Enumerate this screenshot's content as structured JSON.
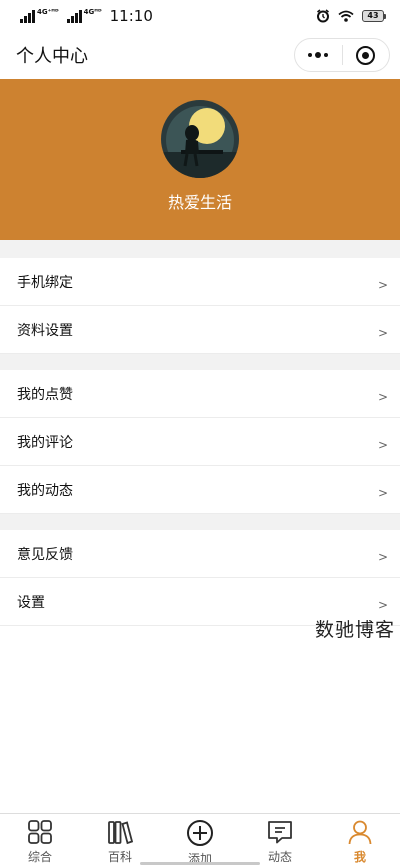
{
  "status_bar": {
    "network_1": "4G⁺ᴴᴰ",
    "network_2": "4Gᴴᴰ",
    "time": "11:10",
    "battery": "43"
  },
  "header": {
    "title": "个人中心"
  },
  "profile": {
    "username": "热爱生活",
    "banner_color": "#cd8230"
  },
  "menu": {
    "groups": [
      {
        "items": [
          {
            "label": "手机绑定"
          },
          {
            "label": "资料设置"
          }
        ]
      },
      {
        "items": [
          {
            "label": "我的点赞"
          },
          {
            "label": "我的评论"
          },
          {
            "label": "我的动态"
          }
        ]
      },
      {
        "items": [
          {
            "label": "意见反馈"
          },
          {
            "label": "设置"
          }
        ]
      }
    ],
    "chevron": ">"
  },
  "watermark": "数驰博客",
  "tab_bar": {
    "active_color": "#d9892f",
    "tabs": [
      {
        "label": "综合",
        "icon": "grid-icon"
      },
      {
        "label": "百科",
        "icon": "books-icon"
      },
      {
        "label": "添加",
        "icon": "plus-circle-icon"
      },
      {
        "label": "动态",
        "icon": "message-icon"
      },
      {
        "label": "我",
        "icon": "user-icon",
        "active": true
      }
    ]
  }
}
